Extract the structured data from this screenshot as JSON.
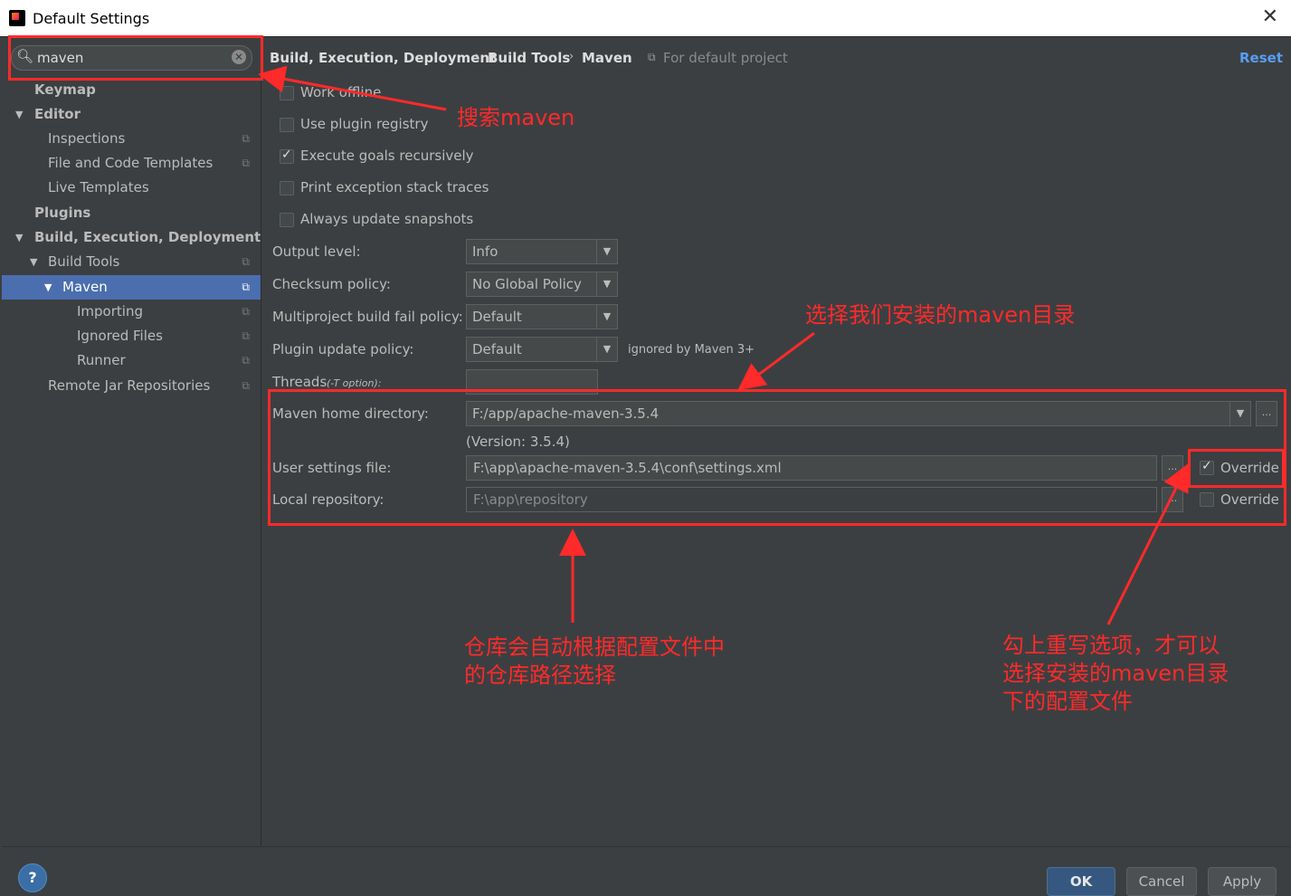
{
  "window": {
    "title": "Default Settings",
    "close": "✕"
  },
  "search": {
    "value": "maven",
    "icon": "search-icon",
    "clear": "✕"
  },
  "tree": {
    "keymap": "Keymap",
    "editor": "Editor",
    "inspections": "Inspections",
    "file_code_templates": "File and Code Templates",
    "live_templates": "Live Templates",
    "plugins": "Plugins",
    "build_exec_deploy": "Build, Execution, Deployment",
    "build_tools": "Build Tools",
    "maven": "Maven",
    "importing": "Importing",
    "ignored_files": "Ignored Files",
    "runner": "Runner",
    "remote_jar_repos": "Remote Jar Repositories",
    "copy_glyph": "⧉",
    "expand_glyph": "▼"
  },
  "breadcrumb": {
    "part1": "Build, Execution, Deployment",
    "part2": "Build Tools",
    "part3": "Maven",
    "sep": "›",
    "scope_icon": "⧉",
    "scope": "For default project",
    "reset": "Reset"
  },
  "options": {
    "work_offline": {
      "label": "Work offline",
      "checked": false
    },
    "use_plugin_registry": {
      "label": "Use plugin registry",
      "checked": false
    },
    "execute_goals": {
      "label": "Execute goals recursively",
      "checked": true
    },
    "print_exception": {
      "label": "Print exception stack traces",
      "checked": false
    },
    "always_update": {
      "label": "Always update snapshots",
      "checked": false
    }
  },
  "form": {
    "output_level": {
      "label": "Output level:",
      "value": "Info"
    },
    "checksum_policy": {
      "label": "Checksum policy:",
      "value": "No Global Policy"
    },
    "multiproject_fail": {
      "label": "Multiproject build fail policy:",
      "value": "Default"
    },
    "plugin_update": {
      "label": "Plugin update policy:",
      "value": "Default",
      "note": "ignored by Maven 3+"
    },
    "threads": {
      "label": "Threads",
      "hint": "(-T option):",
      "value": ""
    },
    "maven_home": {
      "label": "Maven home directory:",
      "value": "F:/app/apache-maven-3.5.4",
      "version": "(Version: 3.5.4)"
    },
    "user_settings": {
      "label": "User settings file:",
      "value": "F:\\app\\apache-maven-3.5.4\\conf\\settings.xml",
      "override_label": "Override",
      "override": true
    },
    "local_repo": {
      "label": "Local repository:",
      "value": "F:\\app\\repository",
      "override_label": "Override",
      "override": false
    },
    "dropdown_glyph": "▼",
    "ellipsis": "..."
  },
  "buttons": {
    "help": "?",
    "ok": "OK",
    "cancel": "Cancel",
    "apply": "Apply"
  },
  "annotations": {
    "search_note": "搜索maven",
    "home_note": "选择我们安装的maven目录",
    "repo_note_line1": "仓库会自动根据配置文件中",
    "repo_note_line2": "的仓库路径选择",
    "override_note_line1": "勾上重写选项，才可以",
    "override_note_line2": "选择安装的maven目录",
    "override_note_line3": "下的配置文件"
  },
  "colors": {
    "background": "#3c3f41",
    "selection": "#4b6eaf",
    "annotation": "#ff2a2a",
    "link": "#589df6"
  }
}
